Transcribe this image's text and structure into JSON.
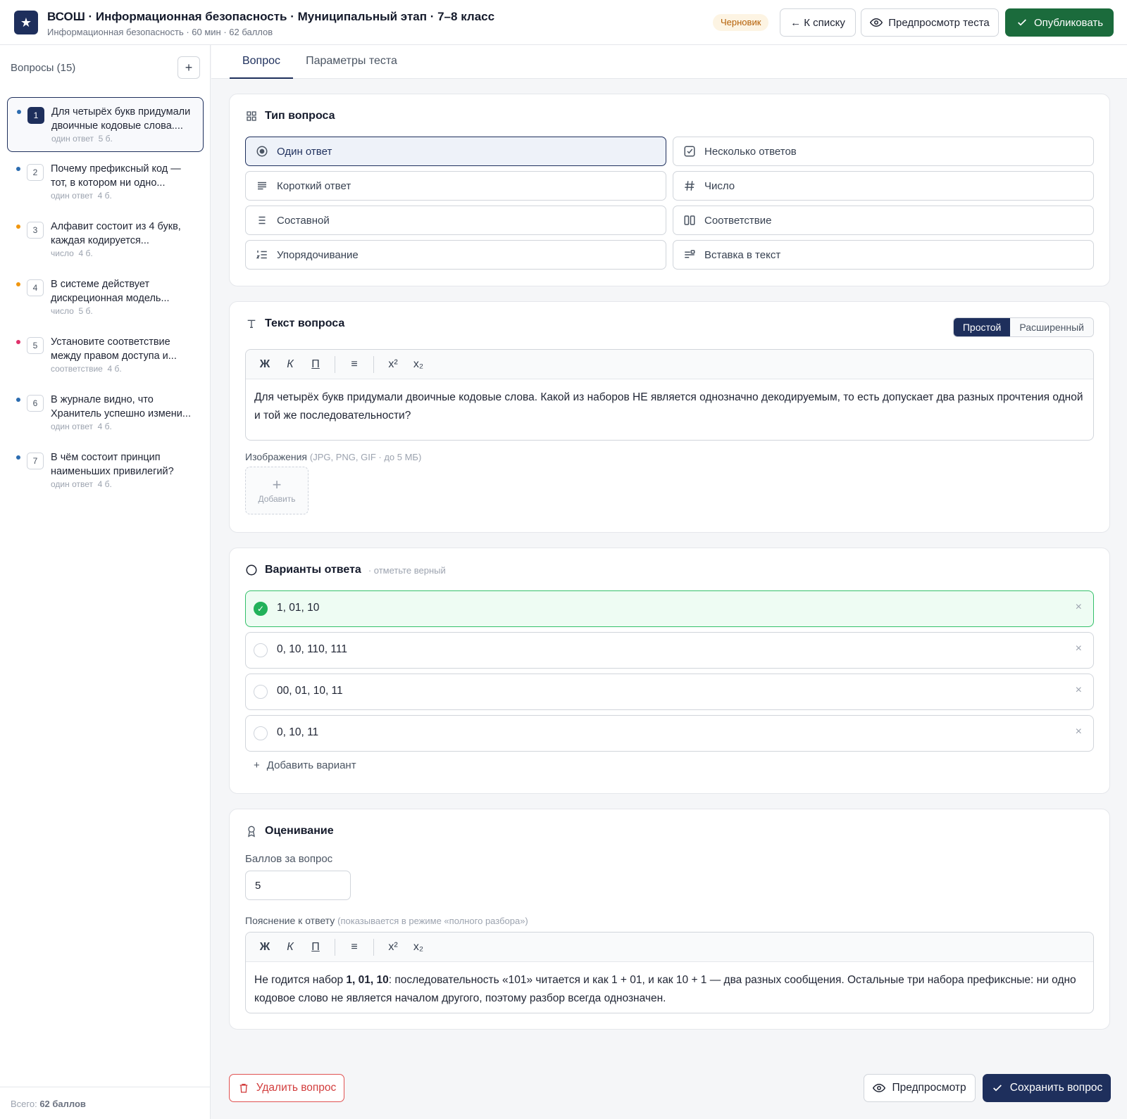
{
  "header": {
    "title": "ВСОШ · Информационная безопасность · Муниципальный этап · 7–8 класс",
    "subtitle": "Информационная безопасность · 60 мин · 62 баллов",
    "status": "Черновик",
    "back_label": "← К списку",
    "preview_label": "Предпросмотр теста",
    "publish_label": "Опубликовать"
  },
  "sidebar": {
    "title": "Вопросы (15)",
    "add_symbol": "+",
    "total_prefix": "Всего: ",
    "total_value": "62 баллов",
    "questions": [
      {
        "num": "1",
        "text": "Для четырёх букв придумали двоичные кодовые слова....",
        "type": "один ответ",
        "points": "5 б.",
        "dot": "#2c6cb0"
      },
      {
        "num": "2",
        "text": "Почему префиксный код — тот, в котором ни одно...",
        "type": "один ответ",
        "points": "4 б.",
        "dot": "#2c6cb0"
      },
      {
        "num": "3",
        "text": "Алфавит состоит из 4 букв, каждая кодируется...",
        "type": "число",
        "points": "4 б.",
        "dot": "#f0960f"
      },
      {
        "num": "4",
        "text": "В системе действует дискреционная модель...",
        "type": "число",
        "points": "5 б.",
        "dot": "#f0960f"
      },
      {
        "num": "5",
        "text": "Установите соответствие между правом доступа и...",
        "type": "соответствие",
        "points": "4 б.",
        "dot": "#e0306a"
      },
      {
        "num": "6",
        "text": "В журнале видно, что Хранитель успешно измени...",
        "type": "один ответ",
        "points": "4 б.",
        "dot": "#2c6cb0"
      },
      {
        "num": "7",
        "text": "В чём состоит принцип наименьших привилегий?",
        "type": "один ответ",
        "points": "4 б.",
        "dot": "#2c6cb0"
      }
    ]
  },
  "tabs": [
    "Вопрос",
    "Параметры теста"
  ],
  "question_type": {
    "heading": "Тип вопроса",
    "options": [
      {
        "label": "Один ответ",
        "icon": "radio-icon",
        "selected": true
      },
      {
        "label": "Несколько ответов",
        "icon": "checkbox-icon",
        "selected": false
      },
      {
        "label": "Короткий ответ",
        "icon": "text-lines-icon",
        "selected": false
      },
      {
        "label": "Число",
        "icon": "hash-icon",
        "selected": false
      },
      {
        "label": "Составной",
        "icon": "list-icon",
        "selected": false
      },
      {
        "label": "Соответствие",
        "icon": "columns-icon",
        "selected": false
      },
      {
        "label": "Упорядочивание",
        "icon": "ordered-list-icon",
        "selected": false
      },
      {
        "label": "Вставка в текст",
        "icon": "insert-text-icon",
        "selected": false
      }
    ]
  },
  "question_text": {
    "heading": "Текст вопроса",
    "mode_simple": "Простой",
    "mode_advanced": "Расширенный",
    "toolbar": {
      "bold": "Ж",
      "italic": "К",
      "underline": "П",
      "list": "≡",
      "sup": "x²",
      "sub": "x₂"
    },
    "body": "Для четырёх букв придумали двоичные кодовые слова. Какой из наборов НЕ является однозначно декодируемым, то есть допускает два разных прочтения одной и той же последовательности?",
    "images_label": "Изображения",
    "images_hint": "(JPG, PNG, GIF · до 5 МБ)",
    "add_image_label": "Добавить"
  },
  "answers": {
    "heading": "Варианты ответа",
    "hint": "· отметьте верный",
    "options": [
      {
        "text": "1, 01, 10",
        "correct": true
      },
      {
        "text": "0, 10, 110, 111",
        "correct": false
      },
      {
        "text": "00, 01, 10, 11",
        "correct": false
      },
      {
        "text": "0, 10, 11",
        "correct": false
      }
    ],
    "add_label": "Добавить вариант"
  },
  "grading": {
    "heading": "Оценивание",
    "points_label": "Баллов за вопрос",
    "points_value": "5",
    "explanation_label": "Пояснение к ответу",
    "explanation_hint": "(показывается в режиме «полного разбора»)",
    "explanation_before": "Не годится набор ",
    "explanation_bold": "1, 01, 10",
    "explanation_after": ": последовательность «101» читается и как 1 + 01, и как 10 + 1 — два разных сообщения. Остальные три набора префиксные: ни одно кодовое слово не является началом другого, поэтому разбор всегда однозначен."
  },
  "footer": {
    "delete_label": "Удалить вопрос",
    "preview_label": "Предпросмотр",
    "save_label": "Сохранить вопрос"
  },
  "colors": {
    "brand": "#1e2f5c",
    "publish": "#1b6b3c",
    "correct": "#22b15a",
    "danger": "#d23c3c"
  }
}
